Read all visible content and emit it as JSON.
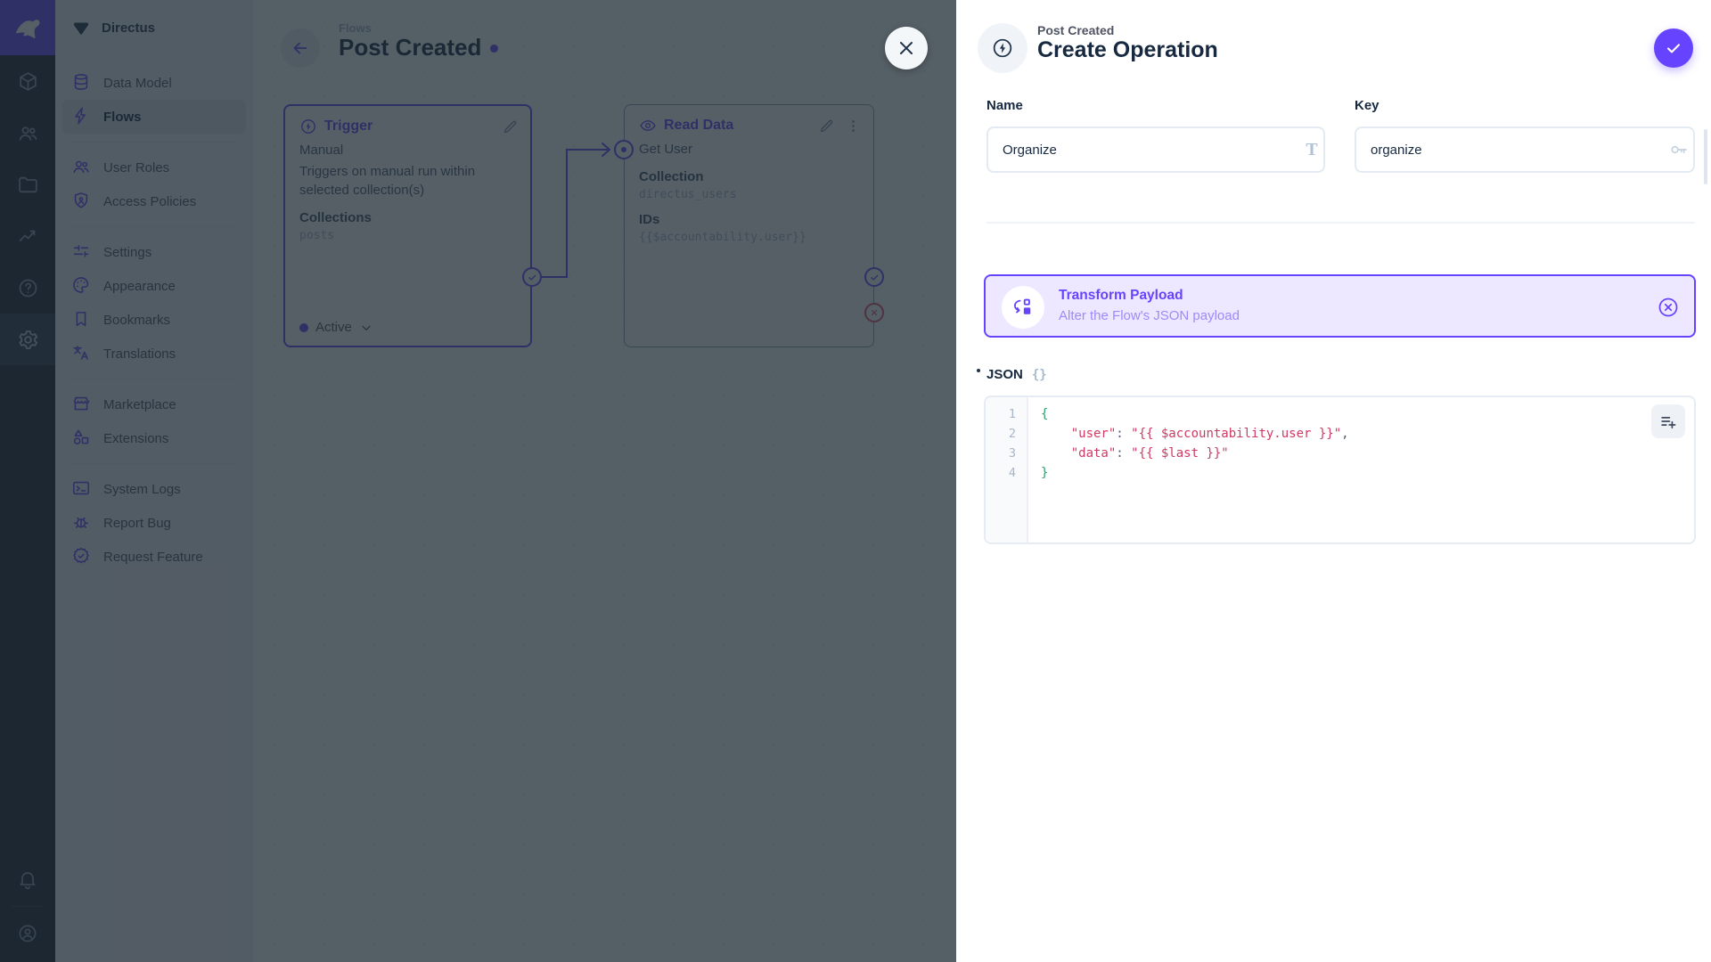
{
  "app": {
    "project_name": "Directus"
  },
  "module_bar": {
    "modules": [
      {
        "name": "content",
        "icon": "box-icon"
      },
      {
        "name": "users",
        "icon": "people-icon"
      },
      {
        "name": "files",
        "icon": "folder-icon"
      },
      {
        "name": "insights",
        "icon": "insights-icon"
      },
      {
        "name": "docs",
        "icon": "help-icon"
      },
      {
        "name": "settings",
        "icon": "gear-icon",
        "active": true
      }
    ],
    "bottom": [
      {
        "name": "notifications",
        "icon": "bell-icon"
      },
      {
        "name": "account",
        "icon": "person-circle-icon"
      }
    ]
  },
  "navigation": {
    "sections": [
      {
        "items": [
          {
            "label": "Data Model",
            "icon": "database-icon",
            "name": "data-model"
          },
          {
            "label": "Flows",
            "icon": "bolt-icon",
            "name": "flows",
            "active": true
          }
        ]
      },
      {
        "items": [
          {
            "label": "User Roles",
            "icon": "users-icon",
            "name": "user-roles"
          },
          {
            "label": "Access Policies",
            "icon": "shield-icon",
            "name": "access-policies"
          }
        ]
      },
      {
        "items": [
          {
            "label": "Settings",
            "icon": "tune-icon",
            "name": "settings"
          },
          {
            "label": "Appearance",
            "icon": "palette-icon",
            "name": "appearance"
          },
          {
            "label": "Bookmarks",
            "icon": "bookmark-icon",
            "name": "bookmarks"
          },
          {
            "label": "Translations",
            "icon": "translate-icon",
            "name": "translations"
          }
        ]
      },
      {
        "items": [
          {
            "label": "Marketplace",
            "icon": "storefront-icon",
            "name": "marketplace"
          },
          {
            "label": "Extensions",
            "icon": "shapes-icon",
            "name": "extensions"
          }
        ]
      },
      {
        "items": [
          {
            "label": "System Logs",
            "icon": "terminal-icon",
            "name": "system-logs"
          },
          {
            "label": "Report Bug",
            "icon": "bug-icon",
            "name": "report-bug"
          },
          {
            "label": "Request Feature",
            "icon": "seal-check-icon",
            "name": "request-feature"
          }
        ]
      }
    ]
  },
  "flow_header": {
    "breadcrumb": "Flows",
    "title": "Post Created"
  },
  "canvas": {
    "trigger": {
      "header": "Trigger",
      "type": "Manual",
      "description": "Triggers on manual run within selected collection(s)",
      "collections_label": "Collections",
      "collections_value": "posts",
      "status": "Active"
    },
    "read": {
      "header": "Read Data",
      "name": "Get User",
      "collection_label": "Collection",
      "collection_value": "directus_users",
      "ids_label": "IDs",
      "ids_value": "{{$accountability.user}}"
    }
  },
  "drawer": {
    "breadcrumb": "Post Created",
    "title": "Create Operation",
    "name_field": {
      "label": "Name",
      "value": "Organize"
    },
    "key_field": {
      "label": "Key",
      "value": "organize"
    },
    "operation_card": {
      "title": "Transform Payload",
      "subtitle": "Alter the Flow's JSON payload"
    },
    "json_field": {
      "label": "JSON",
      "braces_glyph": "{}"
    }
  },
  "editor": {
    "lines": [
      {
        "num": "1",
        "tokens": [
          {
            "t": "{",
            "c": "tok-bracket"
          }
        ]
      },
      {
        "num": "2",
        "tokens": [
          {
            "t": "    ",
            "c": ""
          },
          {
            "t": "\"user\"",
            "c": "tok-string"
          },
          {
            "t": ": ",
            "c": "tok-punct"
          },
          {
            "t": "\"{{ $accountability.user }}\"",
            "c": "tok-string"
          },
          {
            "t": ",",
            "c": "tok-punct"
          }
        ]
      },
      {
        "num": "3",
        "tokens": [
          {
            "t": "    ",
            "c": ""
          },
          {
            "t": "\"data\"",
            "c": "tok-string"
          },
          {
            "t": ": ",
            "c": "tok-punct"
          },
          {
            "t": "\"{{ $last }}\"",
            "c": "tok-string"
          }
        ]
      },
      {
        "num": "4",
        "tokens": [
          {
            "t": "}",
            "c": "tok-bracket"
          }
        ]
      }
    ]
  },
  "colors": {
    "accent": "#6644FF",
    "module_bar_bg": "#18222F",
    "nav_bg": "#F0F4F9",
    "text_dark": "#172940",
    "text_subdued": "#A2B5CD",
    "card_bg": "#EDE8FF",
    "code_string": "#CE3A63",
    "code_bracket": "#2E9E6B",
    "reject_red": "#E35169"
  }
}
